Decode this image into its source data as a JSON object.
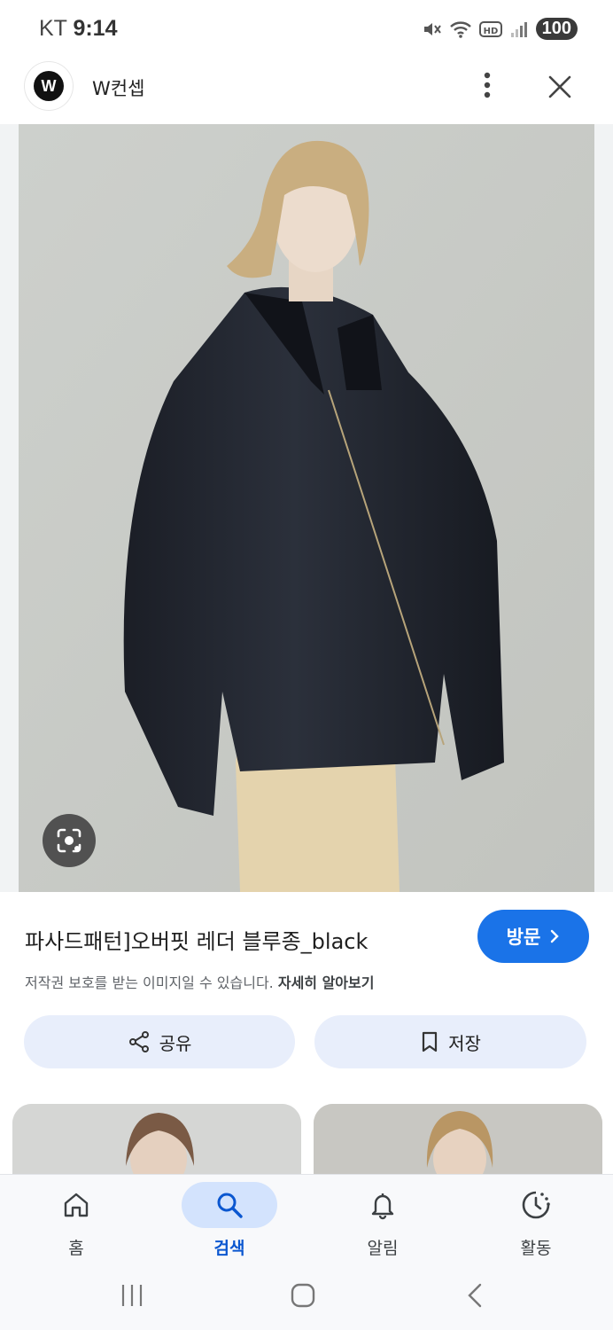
{
  "status_bar": {
    "carrier": "KT",
    "time": "9:14",
    "battery": "100"
  },
  "header": {
    "site_name": "W컨셉",
    "logo_letter": "W"
  },
  "result": {
    "title": "파사드패턴]오버핏 레더 블루종_black",
    "visit_label": "방문",
    "copyright_text": "저작권 보호를 받는 이미지일 수 있습니다.",
    "learn_more": "자세히 알아보기"
  },
  "actions": {
    "share_label": "공유",
    "save_label": "저장"
  },
  "bottom_nav": {
    "items": [
      {
        "label": "홈",
        "icon": "home-icon"
      },
      {
        "label": "검색",
        "icon": "search-icon",
        "active": true
      },
      {
        "label": "알림",
        "icon": "bell-icon"
      },
      {
        "label": "활동",
        "icon": "activity-icon"
      }
    ]
  },
  "colors": {
    "accent": "#1a73e8",
    "chip_bg": "#e8eefb",
    "nav_active_bg": "#d3e3fd"
  }
}
